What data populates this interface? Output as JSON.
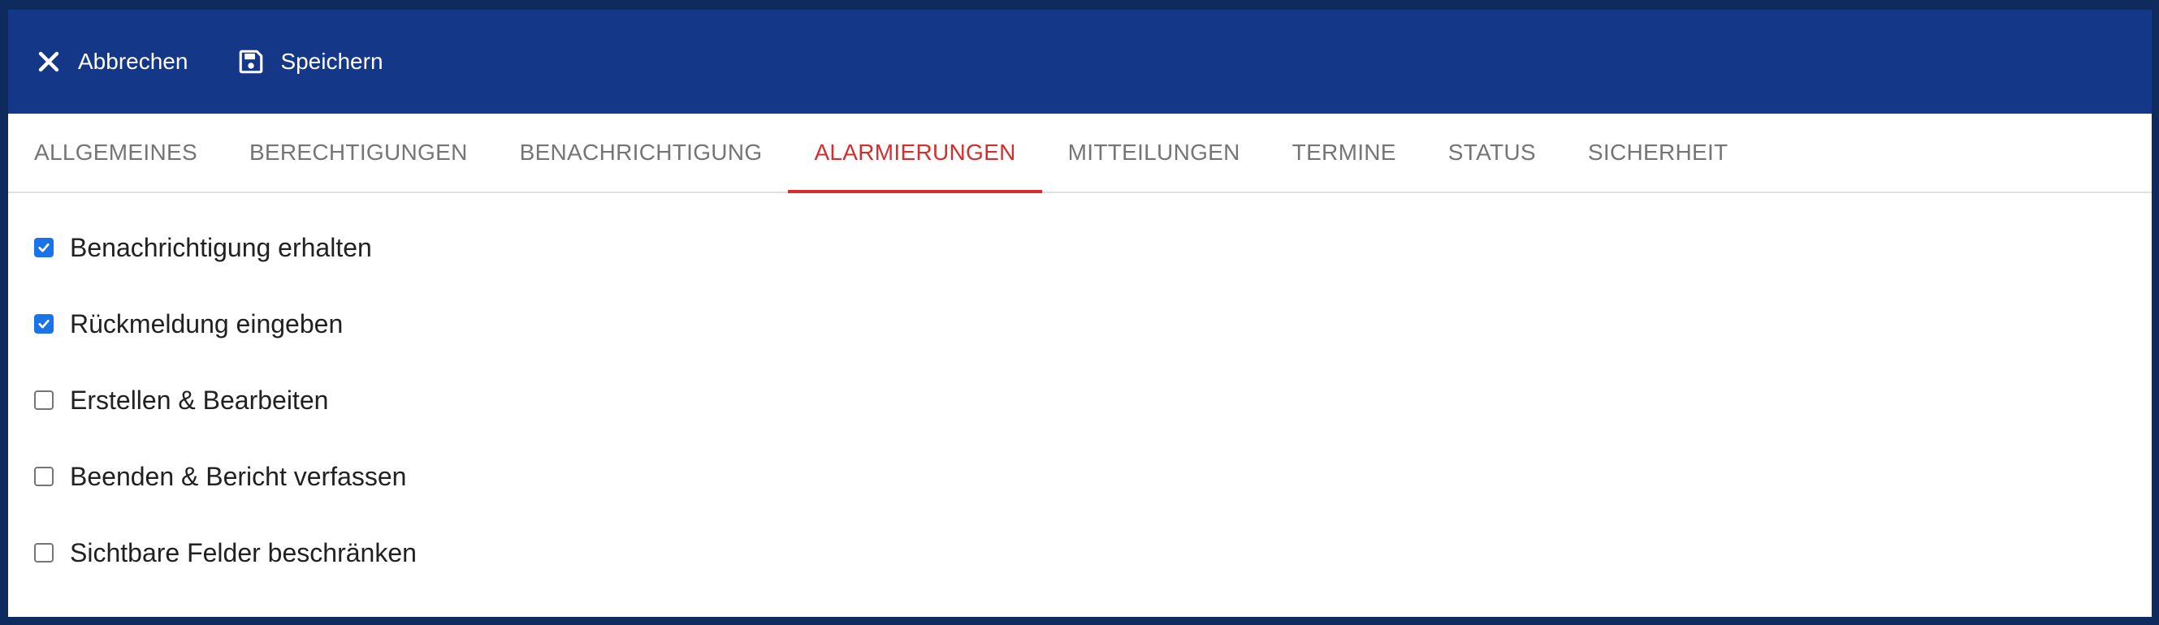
{
  "toolbar": {
    "cancel_label": "Abbrechen",
    "cancel_icon": "close-icon",
    "save_label": "Speichern",
    "save_icon": "floppy-disk-icon",
    "background": "#153788"
  },
  "tabs": [
    {
      "label": "ALLGEMEINES",
      "active": false
    },
    {
      "label": "BERECHTIGUNGEN",
      "active": false
    },
    {
      "label": "BENACHRICHTIGUNG",
      "active": false
    },
    {
      "label": "ALARMIERUNGEN",
      "active": true
    },
    {
      "label": "MITTEILUNGEN",
      "active": false
    },
    {
      "label": "TERMINE",
      "active": false
    },
    {
      "label": "STATUS",
      "active": false
    },
    {
      "label": "SICHERHEIT",
      "active": false
    }
  ],
  "active_tab_color": "#d32f2f",
  "checkboxes": [
    {
      "label": "Benachrichtigung erhalten",
      "checked": true
    },
    {
      "label": "Rückmeldung eingeben",
      "checked": true
    },
    {
      "label": "Erstellen & Bearbeiten",
      "checked": false
    },
    {
      "label": "Beenden & Bericht verfassen",
      "checked": false
    },
    {
      "label": "Sichtbare Felder beschränken",
      "checked": false
    }
  ]
}
